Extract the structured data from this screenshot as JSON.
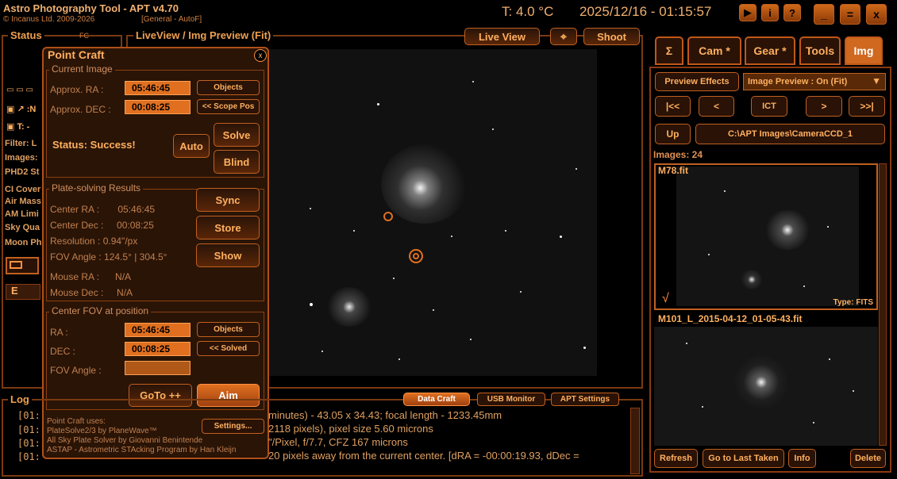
{
  "app": {
    "title": "Astro Photography Tool  -  APT v4.70",
    "copyright": "© Incanus Ltd. 2009-2026",
    "mode": "[General - AutoF]",
    "temperature": "T: 4.0 °C",
    "datetime": "2025/12/16 - 01:15:57",
    "window_buttons": [
      "▶",
      "i",
      "?",
      "_",
      "=",
      "x"
    ]
  },
  "status": {
    "label": "Status",
    "fc_label": "FC",
    "lines": [
      "Filter: L",
      "Images:",
      "PHD2 St",
      "CI Cover",
      "Air Mass",
      "AM Limi",
      "Sky Qua",
      "Moon Ph"
    ],
    "icon_rows": [
      "N",
      "T: -"
    ],
    "e_label": "E"
  },
  "liveview": {
    "label": "LiveView / Img Preview (Fit)",
    "live_view_btn": "Live View",
    "crosshair_btn": "⌖",
    "shoot_btn": "Shoot"
  },
  "point_craft": {
    "title": "Point Craft",
    "close": "x",
    "current_image": {
      "label": "Current Image",
      "ra_label": "Approx. RA :",
      "ra_value": "05:46:45",
      "dec_label": "Approx. DEC :",
      "dec_value": "00:08:25",
      "objects_btn": "Objects",
      "scope_pos_btn": "<< Scope Pos",
      "status_text": "Status: Success!",
      "auto_btn": "Auto",
      "solve_btn": "Solve",
      "blind_btn": "Blind"
    },
    "results": {
      "label": "Plate-solving Results",
      "center_ra": "Center RA :       05:46:45",
      "center_dec": "Center Dec :     00:08:25",
      "resolution": "Resolution : 0.94\"/px",
      "fov_angle": "FOV Angle : 124.5° | 304.5°",
      "mouse_ra": "Mouse RA :      N/A",
      "mouse_dec": "Mouse Dec :     N/A",
      "sync_btn": "Sync",
      "store_btn": "Store",
      "show_btn": "Show"
    },
    "center_fov": {
      "label": "Center FOV at position",
      "ra_label": "RA :",
      "ra_value": "05:46:45",
      "dec_label": "DEC :",
      "dec_value": "00:08:25",
      "fov_label": "FOV Angle :",
      "objects_btn": "Objects",
      "solved_btn": "<< Solved",
      "goto_btn": "GoTo ++",
      "aim_btn": "Aim"
    },
    "credits": [
      "Point Craft uses:",
      "PlateSolve2/3 by PlaneWave™",
      "All Sky Plate Solver by Giovanni Benintende",
      "ASTAP - Astrometric STAcking Program by Han Kleijn"
    ],
    "settings_btn": "Settings..."
  },
  "log": {
    "label": "Log",
    "tabs": [
      "Data Craft",
      "USB Monitor",
      "APT Settings"
    ],
    "lines": [
      "[01:",
      "[01:",
      "[01:",
      "[01:"
    ],
    "line_tails": [
      "minutes) - 43.05 x 34.43; focal length - 1233.45mm",
      "2118 pixels), pixel size 5.60 microns",
      "\"/Pixel, f/7.7, CFZ 167 microns",
      "20 pixels away from the current center. [dRA = -00:00:19.93, dDec ="
    ]
  },
  "right_panel": {
    "tabs": [
      "Σ",
      "Cam *",
      "Gear *",
      "Tools",
      "Img"
    ],
    "preview_effects_btn": "Preview Effects",
    "image_preview_select": "Image Preview : On (Fit)",
    "nav_buttons": [
      "|<<",
      "<",
      "ICT",
      ">",
      ">>|"
    ],
    "up_btn": "Up",
    "path": "C:\\APT Images\\CameraCCD_1",
    "images_count": "Images: 24",
    "thumb1_name": "M78.fit",
    "thumb1_check": "√",
    "thumb1_type": "Type: FITS",
    "thumb2_name": "M101_L_2015-04-12_01-05-43.fit",
    "bottom_buttons": [
      "Refresh",
      "Go to Last Taken",
      "Info",
      "Delete"
    ]
  }
}
